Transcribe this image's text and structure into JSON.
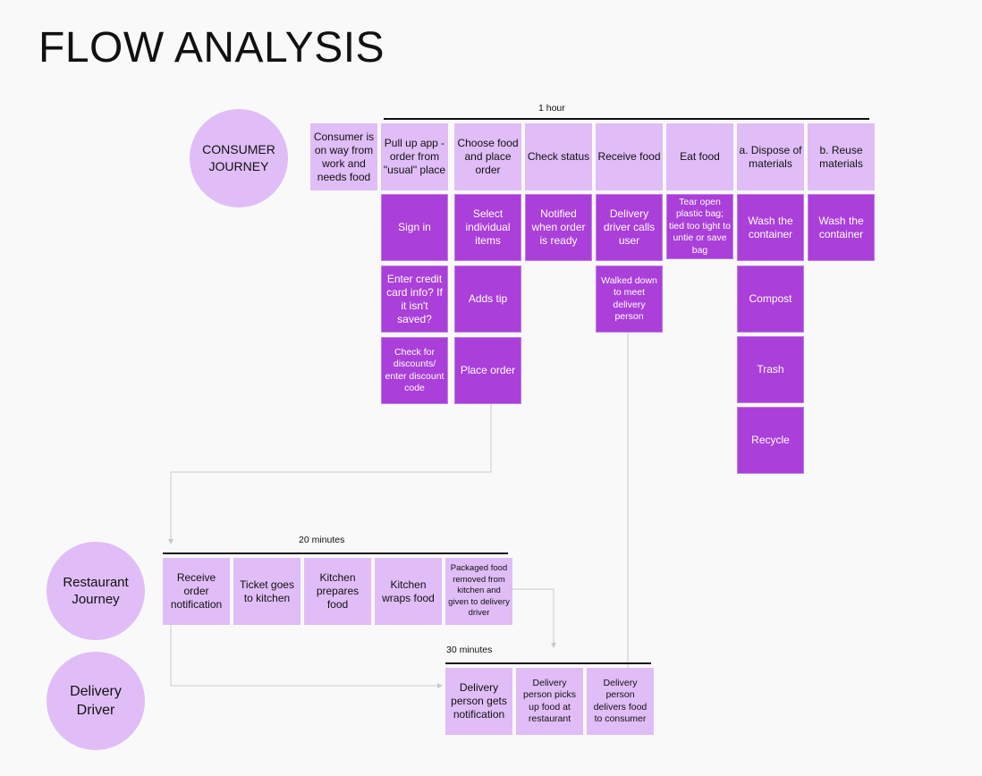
{
  "title": "FLOW ANALYSIS",
  "colors": {
    "light_step": "#e0bdf7",
    "dark_step": "#aa3fd9",
    "connector": "#cccccc",
    "timeline": "#111111"
  },
  "consumer": {
    "label": "CONSUMER JOURNEY",
    "duration": "1 hour",
    "context": "Consumer is on way from work and needs food",
    "stages": [
      {
        "label": "Pull up app - order from \"usual\" place",
        "details": [
          "Sign in",
          "Enter credit card info? If it isn't saved?",
          "Check for discounts/ enter discount code"
        ]
      },
      {
        "label": "Choose food and place order",
        "details": [
          "Select individual items",
          "Adds tip",
          "Place order"
        ]
      },
      {
        "label": "Check status",
        "details": [
          "Notified when order is ready"
        ]
      },
      {
        "label": "Receive food",
        "details": [
          "Delivery driver calls user",
          "Walked down to meet delivery person"
        ]
      },
      {
        "label": "Eat food",
        "details": [
          "Tear open plastic bag; tied too tight to untie or save bag"
        ]
      },
      {
        "label": "a. Dispose of materials",
        "details": [
          "Wash the container",
          "Compost",
          "Trash",
          "Recycle"
        ]
      },
      {
        "label": "b. Reuse materials",
        "details": [
          "Wash the container"
        ]
      }
    ]
  },
  "restaurant": {
    "label": "Restaurant Journey",
    "duration": "20 minutes",
    "stages": [
      "Receive order notification",
      "Ticket goes to kitchen",
      "Kitchen prepares food",
      "Kitchen wraps food",
      "Packaged food removed from kitchen and given to delivery driver"
    ]
  },
  "delivery": {
    "label": "Delivery Driver",
    "duration": "30 minutes",
    "stages": [
      "Delivery person gets notification",
      "Delivery person picks up food at restaurant",
      "Delivery person delivers food to consumer"
    ]
  }
}
